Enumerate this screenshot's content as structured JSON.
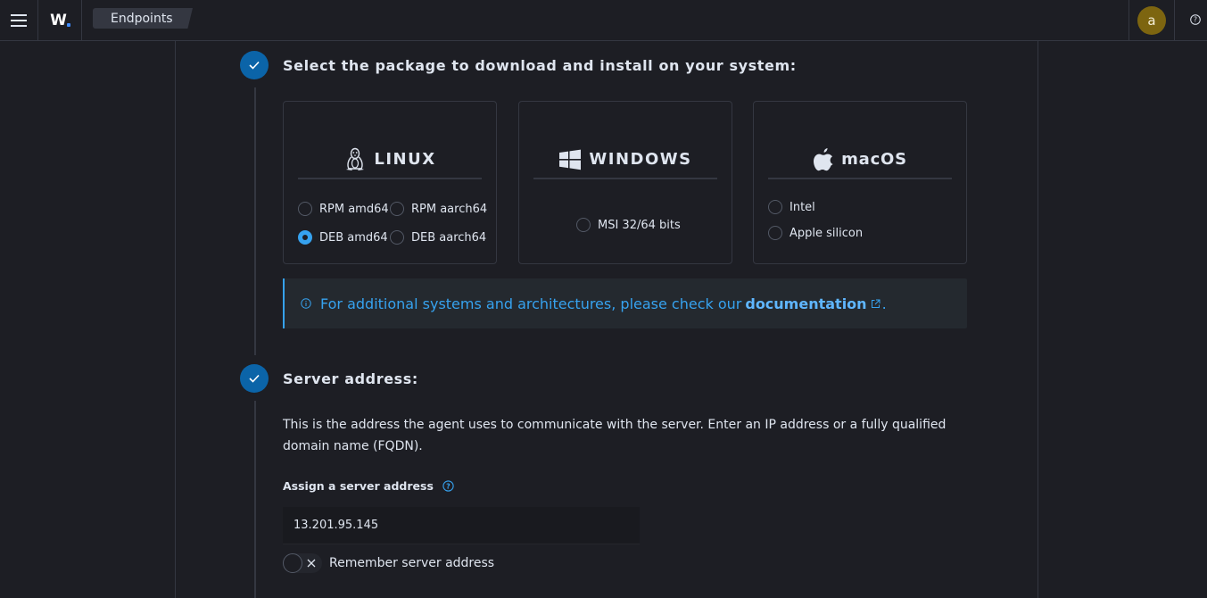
{
  "header": {
    "logo_text": "W",
    "breadcrumb": "Endpoints",
    "avatar_initial": "a"
  },
  "step1": {
    "title": "Select the package to download and install on your system:"
  },
  "os_cards": {
    "linux": {
      "name": "LINUX",
      "options": [
        "RPM amd64",
        "RPM aarch64",
        "DEB amd64",
        "DEB aarch64"
      ],
      "selected": "DEB amd64"
    },
    "windows": {
      "name": "WINDOWS",
      "options": [
        "MSI 32/64 bits"
      ]
    },
    "macos": {
      "name": "macOS",
      "options": [
        "Intel",
        "Apple silicon"
      ]
    }
  },
  "callout": {
    "text": "For additional systems and architectures, please check our",
    "link": "documentation",
    "suffix": "."
  },
  "step2": {
    "title": "Server address:",
    "description": "This is the address the agent uses to communicate with the server. Enter an IP address or a fully qualified domain name (FQDN).",
    "field_label": "Assign a server address",
    "server_address": "13.201.95.145",
    "remember_label": "Remember server address"
  },
  "colors": {
    "accent": "#36a2ef",
    "step": "#0b64a8",
    "avatar": "#7d6510"
  }
}
